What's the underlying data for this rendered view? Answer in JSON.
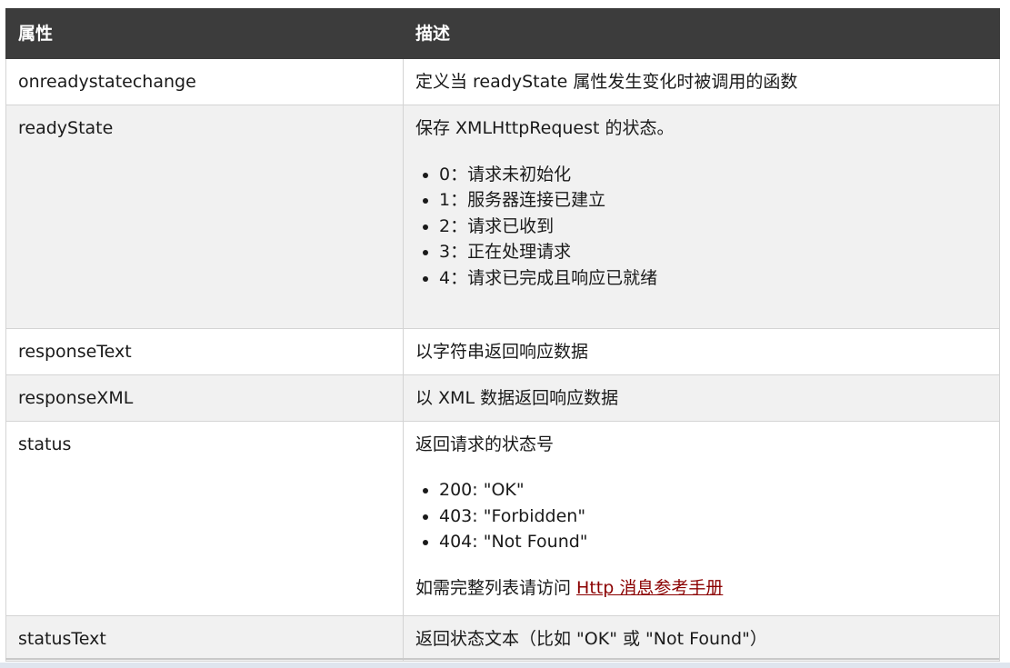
{
  "table": {
    "headers": [
      "属性",
      "描述"
    ],
    "rows": [
      {
        "name": "onreadystatechange",
        "desc": "定义当 readyState 属性发生变化时被调用的函数"
      },
      {
        "name": "readyState",
        "desc": "保存 XMLHttpRequest 的状态。",
        "list": [
          "0：请求未初始化",
          "1：服务器连接已建立",
          "2：请求已收到",
          "3：正在处理请求",
          "4：请求已完成且响应已就绪"
        ]
      },
      {
        "name": "responseText",
        "desc": "以字符串返回响应数据"
      },
      {
        "name": "responseXML",
        "desc": "以 XML 数据返回响应数据"
      },
      {
        "name": "status",
        "desc": "返回请求的状态号",
        "list": [
          "200: \"OK\"",
          "403: \"Forbidden\"",
          "404: \"Not Found\""
        ],
        "more_prefix": "如需完整列表请访问 ",
        "more_link": "Http 消息参考手册"
      },
      {
        "name": "statusText",
        "desc": "返回状态文本（比如 \"OK\" 或 \"Not Found\"）"
      }
    ]
  },
  "colors": {
    "header_bg": "#3c3c3c",
    "header_text": "#ffffff",
    "alt_row_bg": "#f1f1f1",
    "link": "#8b0000"
  }
}
